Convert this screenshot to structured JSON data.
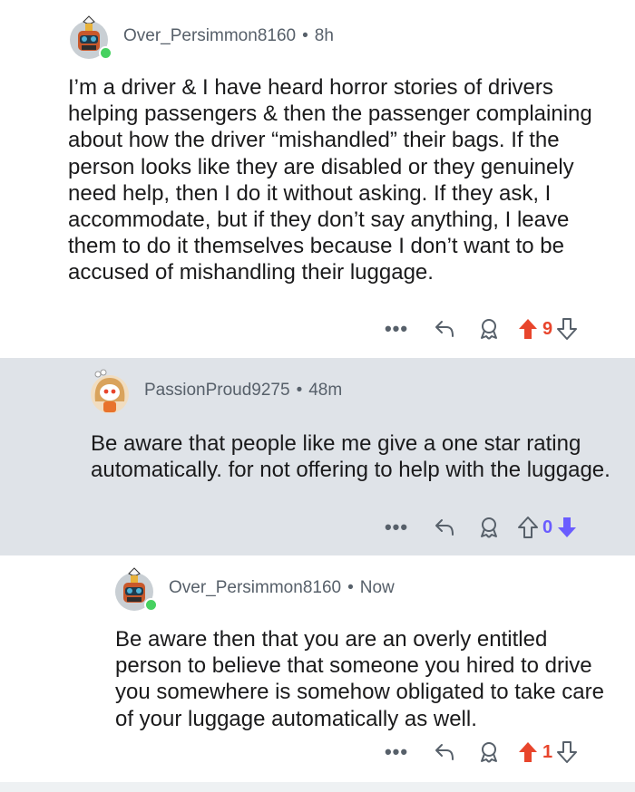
{
  "colors": {
    "upvote_active": "#e8452c",
    "downvote_active": "#6a5cff",
    "meta_text": "#57606a",
    "online": "#46d160",
    "highlight_bg": "#dfe3e8"
  },
  "comments": [
    {
      "username": "Over_Persimmon8160",
      "separator": "•",
      "time": "8h",
      "body": "I’m a driver & I have heard horror stories of drivers helping passengers & then the passenger complaining about how the driver “mishandled” their bags. If the person looks like they are disabled or they genuinely need help, then I do it without asking. If they ask, I accommodate, but if they don’t say anything, I leave them to do it themselves because I don’t want to be accused of mishandling their luggage.",
      "more_label": "•••",
      "score": "9",
      "vote_state": "up",
      "icons": [
        "more-icon",
        "reply-icon",
        "award-icon",
        "upvote-icon",
        "downvote-icon"
      ]
    },
    {
      "username": "PassionProud9275",
      "separator": "•",
      "time": "48m",
      "body": "Be aware that people like me give a one star rating automatically. for not offering to help with the luggage.",
      "more_label": "•••",
      "score": "0",
      "vote_state": "down",
      "icons": [
        "more-icon",
        "reply-icon",
        "award-icon",
        "upvote-icon",
        "downvote-icon"
      ]
    },
    {
      "username": "Over_Persimmon8160",
      "separator": "•",
      "time": "Now",
      "body": "Be aware then that you are an overly entitled person to believe that someone you hired to drive you somewhere is somehow obligated to take care of your luggage automatically as well.",
      "more_label": "•••",
      "score": "1",
      "vote_state": "up",
      "icons": [
        "more-icon",
        "reply-icon",
        "award-icon",
        "upvote-icon",
        "downvote-icon"
      ]
    }
  ]
}
